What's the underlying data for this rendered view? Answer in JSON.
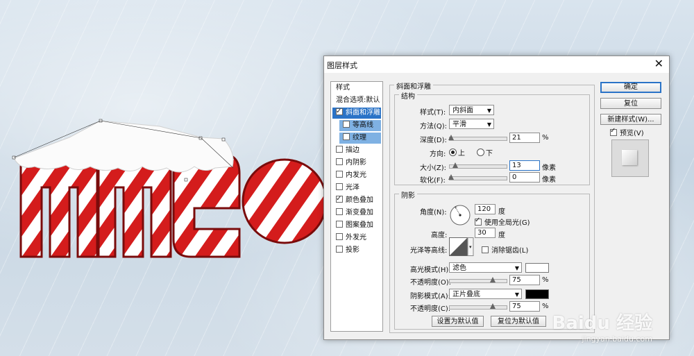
{
  "dialog": {
    "title": "图层样式",
    "close_glyph": "✕"
  },
  "sidebar": {
    "header": "样式",
    "items": [
      {
        "label": "混合选项:默认",
        "checkbox": false
      },
      {
        "label": "斜面和浮雕",
        "checkbox": true,
        "checked": true,
        "selected": true
      },
      {
        "label": "等高线",
        "checkbox": true,
        "checked": false
      },
      {
        "label": "纹理",
        "checkbox": true,
        "checked": false
      },
      {
        "label": "描边",
        "checkbox": true,
        "checked": false
      },
      {
        "label": "内阴影",
        "checkbox": true,
        "checked": false
      },
      {
        "label": "内发光",
        "checkbox": true,
        "checked": false
      },
      {
        "label": "光泽",
        "checkbox": true,
        "checked": false
      },
      {
        "label": "颜色叠加",
        "checkbox": true,
        "checked": true
      },
      {
        "label": "渐变叠加",
        "checkbox": true,
        "checked": false
      },
      {
        "label": "图案叠加",
        "checkbox": true,
        "checked": false
      },
      {
        "label": "外发光",
        "checkbox": true,
        "checked": false
      },
      {
        "label": "投影",
        "checkbox": true,
        "checked": false
      }
    ]
  },
  "bevel": {
    "section_title": "斜面和浮雕",
    "structure_title": "结构",
    "style_label": "样式(T):",
    "style_value": "内斜面",
    "technique_label": "方法(Q):",
    "technique_value": "平滑",
    "depth_label": "深度(D):",
    "depth_value": "21",
    "depth_unit": "%",
    "depth_fraction": 0.02,
    "direction_label": "方向:",
    "direction_up": "上",
    "direction_down": "下",
    "size_label": "大小(Z):",
    "size_value": "13",
    "size_unit": "像素",
    "soften_label": "软化(F):",
    "soften_value": "0",
    "soften_unit": "像素"
  },
  "shading": {
    "title": "阴影",
    "angle_label": "角度(N):",
    "angle_value": "120",
    "angle_unit": "度",
    "global_light_label": "使用全局光(G)",
    "altitude_label": "高度:",
    "altitude_value": "30",
    "altitude_unit": "度",
    "gloss_contour_label": "光泽等高线:",
    "antialias_label": "消除锯齿(L)",
    "highlight_mode_label": "高光模式(H):",
    "highlight_mode_value": "滤色",
    "highlight_color": "#ffffff",
    "highlight_opacity_label": "不透明度(O):",
    "highlight_opacity_value": "75",
    "highlight_opacity_unit": "%",
    "shadow_mode_label": "阴影模式(A):",
    "shadow_mode_value": "正片叠底",
    "shadow_color": "#000000",
    "shadow_opacity_label": "不透明度(C):",
    "shadow_opacity_value": "75",
    "shadow_opacity_unit": "%"
  },
  "buttons": {
    "ok": "确定",
    "reset": "复位",
    "new_style": "新建样式(W)...",
    "preview": "预览(V)",
    "make_default": "设置为默认值",
    "reset_default": "复位为默认值"
  },
  "watermark": {
    "brand": "Baidu",
    "cn": "经验",
    "url": "jingyan.baidu.com"
  },
  "colors": {
    "accent": "#2a73c7",
    "candy_red": "#d41c1c"
  }
}
